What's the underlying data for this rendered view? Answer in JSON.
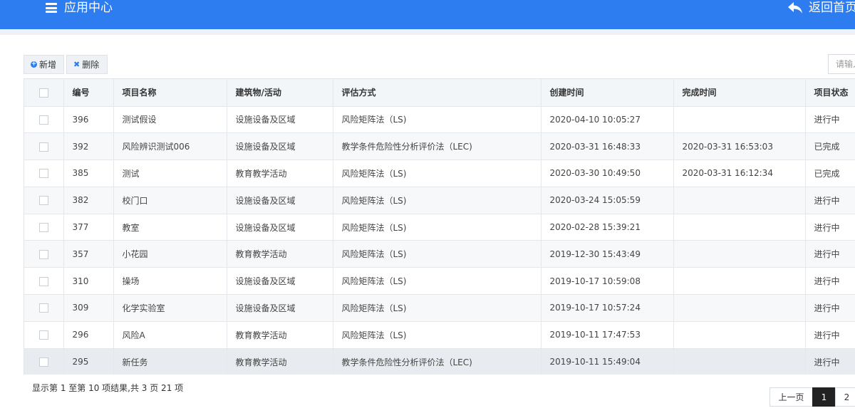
{
  "header": {
    "app_title": "应用中心",
    "back_label": "返回首页"
  },
  "toolbar": {
    "add_label": "新增",
    "delete_label": "删除"
  },
  "search": {
    "placeholder": "请输入"
  },
  "table": {
    "columns": [
      "编号",
      "项目名称",
      "建筑物/活动",
      "评估方式",
      "创建时间",
      "完成时间",
      "项目状态"
    ],
    "rows": [
      {
        "id": "396",
        "name": "测试假设",
        "building": "设施设备及区域",
        "method": "风险矩阵法（LS)",
        "created": "2020-04-10 10:05:27",
        "completed": "",
        "status": "进行中"
      },
      {
        "id": "392",
        "name": "风险辨识测试006",
        "building": "设施设备及区域",
        "method": "教学条件危险性分析评价法（LEC)",
        "created": "2020-03-31 16:48:33",
        "completed": "2020-03-31 16:53:03",
        "status": "已完成"
      },
      {
        "id": "385",
        "name": "测试",
        "building": "教育教学活动",
        "method": "风险矩阵法（LS)",
        "created": "2020-03-30 10:49:50",
        "completed": "2020-03-31 16:12:34",
        "status": "已完成"
      },
      {
        "id": "382",
        "name": "校门口",
        "building": "设施设备及区域",
        "method": "风险矩阵法（LS)",
        "created": "2020-03-24 15:05:59",
        "completed": "",
        "status": "进行中"
      },
      {
        "id": "377",
        "name": "教室",
        "building": "设施设备及区域",
        "method": "风险矩阵法（LS)",
        "created": "2020-02-28 15:39:21",
        "completed": "",
        "status": "进行中"
      },
      {
        "id": "357",
        "name": "小花园",
        "building": "教育教学活动",
        "method": "风险矩阵法（LS)",
        "created": "2019-12-30 15:43:49",
        "completed": "",
        "status": "进行中"
      },
      {
        "id": "310",
        "name": "操场",
        "building": "设施设备及区域",
        "method": "风险矩阵法（LS)",
        "created": "2019-10-17 10:59:08",
        "completed": "",
        "status": "进行中"
      },
      {
        "id": "309",
        "name": "化学实验室",
        "building": "设施设备及区域",
        "method": "风险矩阵法（LS)",
        "created": "2019-10-17 10:57:24",
        "completed": "",
        "status": "进行中"
      },
      {
        "id": "296",
        "name": "风险A",
        "building": "教育教学活动",
        "method": "风险矩阵法（LS)",
        "created": "2019-10-11 17:47:53",
        "completed": "",
        "status": "进行中"
      },
      {
        "id": "295",
        "name": "新任务",
        "building": "教育教学活动",
        "method": "教学条件危险性分析评价法（LEC)",
        "created": "2019-10-11 15:49:04",
        "completed": "",
        "status": "进行中"
      }
    ]
  },
  "footer": {
    "summary": "显示第 1 至第 10 项结果,共 3 页 21 项",
    "prev_label": "上一页",
    "pages": [
      "1",
      "2"
    ]
  },
  "colors": {
    "brand": "#2d7cf0",
    "header_bg": "#f3f6f9",
    "active_page": "#222222"
  }
}
